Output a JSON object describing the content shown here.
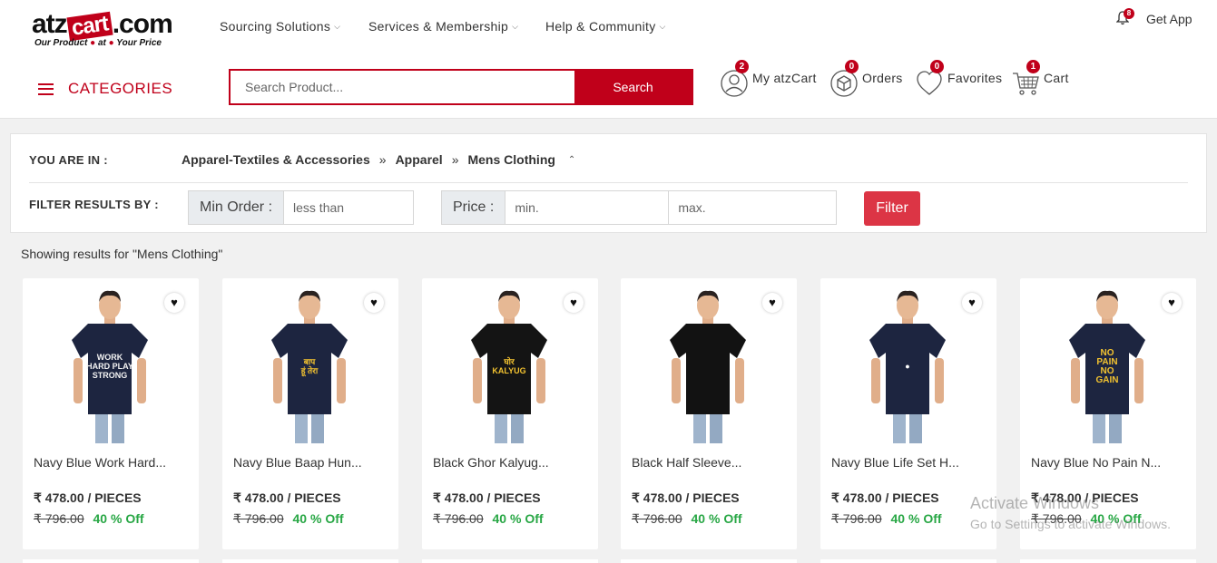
{
  "logo": {
    "left": "atz",
    "cart": "cart",
    "right": ".com",
    "tagline_1": "Our Product",
    "tagline_2": "at",
    "tagline_3": "Your Price"
  },
  "topnav": {
    "items": [
      {
        "label": "Sourcing Solutions"
      },
      {
        "label": "Services & Membership"
      },
      {
        "label": "Help & Community"
      }
    ],
    "notification_count": "8",
    "get_app": "Get App"
  },
  "categories_label": "CATEGORIES",
  "search": {
    "placeholder": "Search Product...",
    "button": "Search"
  },
  "header_links": {
    "my_atzcart": {
      "label": "My atzCart",
      "count": "2"
    },
    "orders": {
      "label": "Orders",
      "count": "0"
    },
    "favorites": {
      "label": "Favorites",
      "count": "0"
    },
    "cart": {
      "label": "Cart",
      "count": "1"
    }
  },
  "breadcrumb": {
    "prefix": "YOU ARE IN :",
    "items": [
      "Apparel-Textiles & Accessories",
      "Apparel",
      "Mens Clothing"
    ],
    "separator": "»"
  },
  "filters": {
    "heading": "FILTER RESULTS BY :",
    "min_order_label": "Min Order :",
    "min_order_placeholder": "less than",
    "price_label": "Price :",
    "price_min_placeholder": "min.",
    "price_max_placeholder": "max.",
    "button": "Filter"
  },
  "results_text": "Showing results for \"Mens Clothing\"",
  "products": [
    {
      "name": "Navy Blue Work Hard...",
      "price": "₹ 478.00 / PIECES",
      "old_price": "₹ 796.00",
      "discount": "40 % Off",
      "shirt_color": "#1d2540",
      "print": "WORK\nHARD PLAY\nSTRONG",
      "print_color": "#f2f2f2"
    },
    {
      "name": "Navy Blue Baap Hun...",
      "price": "₹ 478.00 / PIECES",
      "old_price": "₹ 796.00",
      "discount": "40 % Off",
      "shirt_color": "#1d2540",
      "print": "बाप\nहूं तेरा",
      "print_color": "#f2c230"
    },
    {
      "name": "Black Ghor Kalyug...",
      "price": "₹ 478.00 / PIECES",
      "old_price": "₹ 796.00",
      "discount": "40 % Off",
      "shirt_color": "#141414",
      "print": "घोर\nKALYUG",
      "print_color": "#f2c230"
    },
    {
      "name": "Black Half Sleeve...",
      "price": "₹ 478.00 / PIECES",
      "old_price": "₹ 796.00",
      "discount": "40 % Off",
      "shirt_color": "#121212",
      "print": "",
      "print_color": "#ffffff"
    },
    {
      "name": "Navy Blue Life Set H...",
      "price": "₹ 478.00 / PIECES",
      "old_price": "₹ 796.00",
      "discount": "40 % Off",
      "shirt_color": "#1d2540",
      "print": "●",
      "print_color": "#ffffff"
    },
    {
      "name": "Navy Blue No Pain N...",
      "price": "₹ 478.00 / PIECES",
      "old_price": "₹ 796.00",
      "discount": "40 % Off",
      "shirt_color": "#1d2540",
      "print": "NO\nPAIN\nNO\nGAIN",
      "print_color": "#f2c230"
    }
  ],
  "watermark": {
    "line1": "Activate Windows",
    "line2": "Go to Settings to activate Windows."
  },
  "colors": {
    "brand_red": "#c0001a",
    "filter_red": "#dc3545",
    "discount_green": "#28a745"
  }
}
